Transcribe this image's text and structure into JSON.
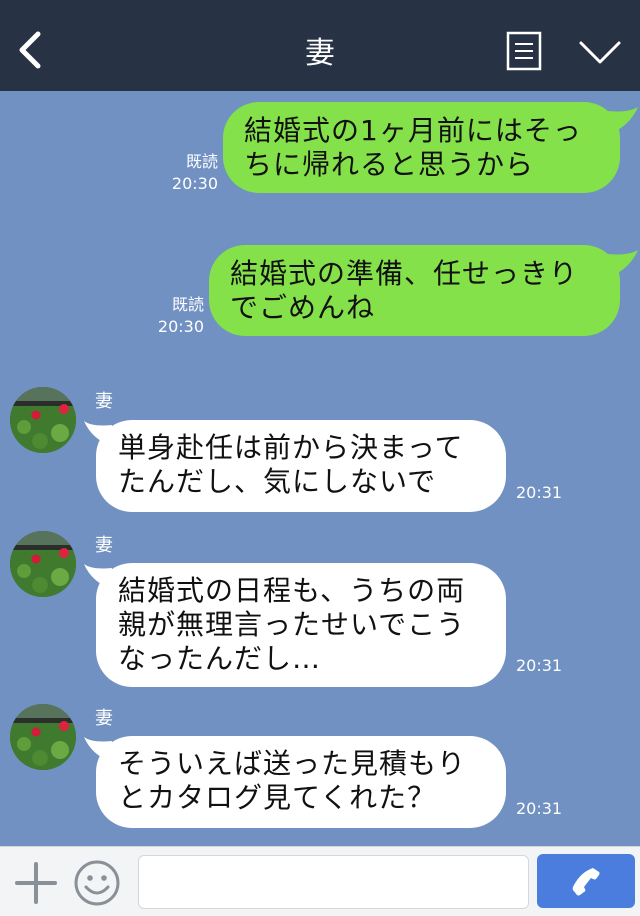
{
  "header": {
    "title": "妻",
    "back_icon": "chevron-left-icon",
    "menu_icon": "list-menu-icon",
    "collapse_icon": "chevron-down-icon",
    "bg_color": "#273244"
  },
  "chat": {
    "bg_color": "#7091c1",
    "sent_bubble_color": "#84e14a",
    "received_bubble_color": "#ffffff",
    "messages": [
      {
        "direction": "outgoing",
        "lines": [
          "結婚式の1ヶ月前にはそっ",
          "ちに帰れると思うから"
        ],
        "read_label": "既読",
        "time": "20:30"
      },
      {
        "direction": "outgoing",
        "lines": [
          "結婚式の準備、任せっきり",
          "でごめんね"
        ],
        "read_label": "既読",
        "time": "20:30"
      },
      {
        "direction": "incoming",
        "sender": "妻",
        "lines": [
          "単身赴任は前から決まって",
          "たんだし、気にしないで"
        ],
        "time": "20:31"
      },
      {
        "direction": "incoming",
        "sender": "妻",
        "lines": [
          "結婚式の日程も、うちの両",
          "親が無理言ったせいでこう",
          "なったんだし…"
        ],
        "time": "20:31"
      },
      {
        "direction": "incoming",
        "sender": "妻",
        "lines": [
          "そういえば送った見積もり",
          "とカタログ見てくれた？"
        ],
        "time": "20:31"
      }
    ]
  },
  "footer": {
    "plus_icon": "plus-icon",
    "emoji_icon": "smiley-icon",
    "input_value": "",
    "call_icon": "phone-icon",
    "call_color": "#4a7ddd"
  }
}
